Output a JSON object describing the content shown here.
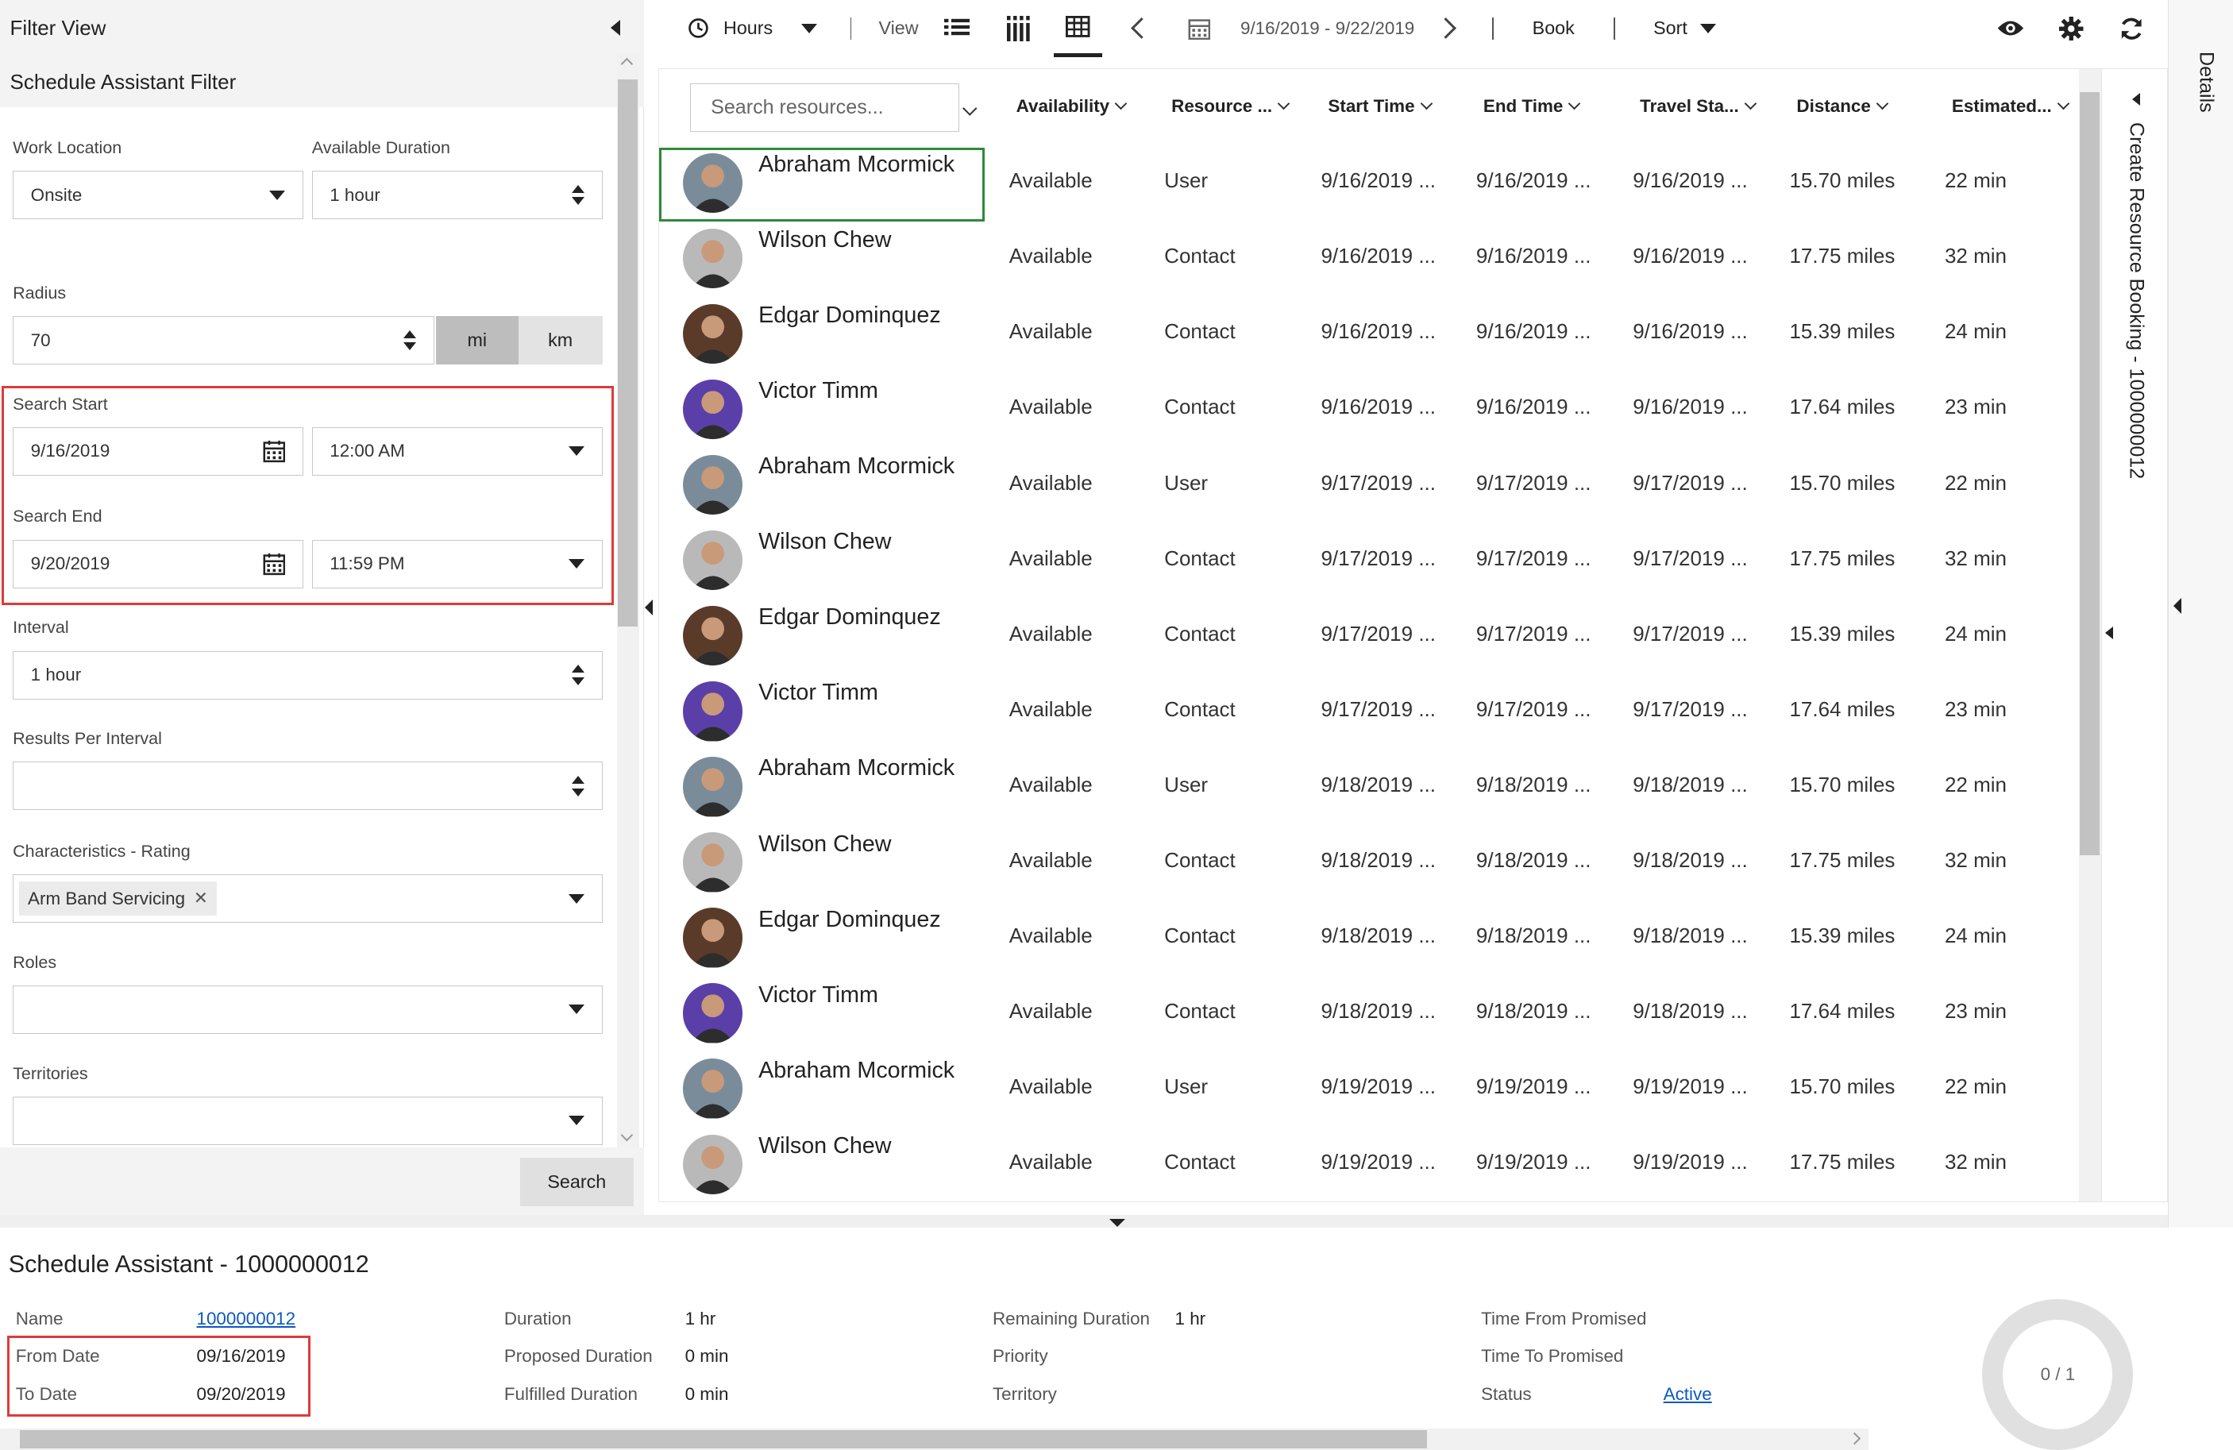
{
  "filter": {
    "title": "Filter View",
    "subtitle": "Schedule Assistant Filter",
    "work_location": {
      "label": "Work Location",
      "value": "Onsite"
    },
    "available_duration": {
      "label": "Available Duration",
      "value": "1 hour"
    },
    "radius": {
      "label": "Radius",
      "value": "70",
      "unit_mi": "mi",
      "unit_km": "km",
      "selected_unit": "mi"
    },
    "search_start": {
      "label": "Search Start",
      "date": "9/16/2019",
      "time": "12:00 AM"
    },
    "search_end": {
      "label": "Search End",
      "date": "9/20/2019",
      "time": "11:59 PM"
    },
    "interval": {
      "label": "Interval",
      "value": "1 hour"
    },
    "results_per_interval": {
      "label": "Results Per Interval",
      "value": ""
    },
    "characteristics": {
      "label": "Characteristics - Rating",
      "tag": "Arm Band Servicing"
    },
    "roles": {
      "label": "Roles",
      "value": ""
    },
    "territories": {
      "label": "Territories",
      "value": ""
    },
    "search_button": "Search"
  },
  "toolbar": {
    "hours": "Hours",
    "view": "View",
    "date_range": "9/16/2019 - 9/22/2019",
    "book": "Book",
    "sort": "Sort"
  },
  "grid": {
    "search_placeholder": "Search resources...",
    "columns": [
      "Availability",
      "Resource ...",
      "Start Time",
      "End Time",
      "Travel Sta...",
      "Distance",
      "Estimated..."
    ],
    "rows": [
      {
        "name": "Abraham Mcormick",
        "availability": "Available",
        "type": "User",
        "start": "9/16/2019 ...",
        "end": "9/16/2019 ...",
        "travel": "9/16/2019 ...",
        "distance": "15.70 miles",
        "est": "22 min",
        "avatar": "a"
      },
      {
        "name": "Wilson Chew",
        "availability": "Available",
        "type": "Contact",
        "start": "9/16/2019 ...",
        "end": "9/16/2019 ...",
        "travel": "9/16/2019 ...",
        "distance": "17.75 miles",
        "est": "32 min",
        "avatar": "w"
      },
      {
        "name": "Edgar Dominquez",
        "availability": "Available",
        "type": "Contact",
        "start": "9/16/2019 ...",
        "end": "9/16/2019 ...",
        "travel": "9/16/2019 ...",
        "distance": "15.39 miles",
        "est": "24 min",
        "avatar": "e"
      },
      {
        "name": "Victor Timm",
        "availability": "Available",
        "type": "Contact",
        "start": "9/16/2019 ...",
        "end": "9/16/2019 ...",
        "travel": "9/16/2019 ...",
        "distance": "17.64 miles",
        "est": "23 min",
        "avatar": "v"
      },
      {
        "name": "Abraham Mcormick",
        "availability": "Available",
        "type": "User",
        "start": "9/17/2019 ...",
        "end": "9/17/2019 ...",
        "travel": "9/17/2019 ...",
        "distance": "15.70 miles",
        "est": "22 min",
        "avatar": "a"
      },
      {
        "name": "Wilson Chew",
        "availability": "Available",
        "type": "Contact",
        "start": "9/17/2019 ...",
        "end": "9/17/2019 ...",
        "travel": "9/17/2019 ...",
        "distance": "17.75 miles",
        "est": "32 min",
        "avatar": "w"
      },
      {
        "name": "Edgar Dominquez",
        "availability": "Available",
        "type": "Contact",
        "start": "9/17/2019 ...",
        "end": "9/17/2019 ...",
        "travel": "9/17/2019 ...",
        "distance": "15.39 miles",
        "est": "24 min",
        "avatar": "e"
      },
      {
        "name": "Victor Timm",
        "availability": "Available",
        "type": "Contact",
        "start": "9/17/2019 ...",
        "end": "9/17/2019 ...",
        "travel": "9/17/2019 ...",
        "distance": "17.64 miles",
        "est": "23 min",
        "avatar": "v"
      },
      {
        "name": "Abraham Mcormick",
        "availability": "Available",
        "type": "User",
        "start": "9/18/2019 ...",
        "end": "9/18/2019 ...",
        "travel": "9/18/2019 ...",
        "distance": "15.70 miles",
        "est": "22 min",
        "avatar": "a"
      },
      {
        "name": "Wilson Chew",
        "availability": "Available",
        "type": "Contact",
        "start": "9/18/2019 ...",
        "end": "9/18/2019 ...",
        "travel": "9/18/2019 ...",
        "distance": "17.75 miles",
        "est": "32 min",
        "avatar": "w"
      },
      {
        "name": "Edgar Dominquez",
        "availability": "Available",
        "type": "Contact",
        "start": "9/18/2019 ...",
        "end": "9/18/2019 ...",
        "travel": "9/18/2019 ...",
        "distance": "15.39 miles",
        "est": "24 min",
        "avatar": "e"
      },
      {
        "name": "Victor Timm",
        "availability": "Available",
        "type": "Contact",
        "start": "9/18/2019 ...",
        "end": "9/18/2019 ...",
        "travel": "9/18/2019 ...",
        "distance": "17.64 miles",
        "est": "23 min",
        "avatar": "v"
      },
      {
        "name": "Abraham Mcormick",
        "availability": "Available",
        "type": "User",
        "start": "9/19/2019 ...",
        "end": "9/19/2019 ...",
        "travel": "9/19/2019 ...",
        "distance": "15.70 miles",
        "est": "22 min",
        "avatar": "a"
      },
      {
        "name": "Wilson Chew",
        "availability": "Available",
        "type": "Contact",
        "start": "9/19/2019 ...",
        "end": "9/19/2019 ...",
        "travel": "9/19/2019 ...",
        "distance": "17.75 miles",
        "est": "32 min",
        "avatar": "w"
      }
    ]
  },
  "side": {
    "create_booking": "Create Resource Booking - 1000000012",
    "details": "Details"
  },
  "bottom": {
    "title": "Schedule Assistant - 1000000012",
    "name_label": "Name",
    "name_value": "1000000012",
    "from_label": "From Date",
    "from_value": "09/16/2019",
    "to_label": "To Date",
    "to_value": "09/20/2019",
    "duration_label": "Duration",
    "duration_value": "1 hr",
    "proposed_label": "Proposed Duration",
    "proposed_value": "0 min",
    "fulfilled_label": "Fulfilled Duration",
    "fulfilled_value": "0 min",
    "remaining_label": "Remaining Duration",
    "remaining_value": "1 hr",
    "priority_label": "Priority",
    "territory_label": "Territory",
    "tfp_label": "Time From Promised",
    "ttp_label": "Time To Promised",
    "status_label": "Status",
    "status_value": "Active",
    "progress_text": "0 / 1"
  },
  "colors": {
    "accent": "#0b58c4",
    "highlight_border": "#e03a3a",
    "selected_border": "#2f8a3a",
    "avatar_a": "#7a8c99",
    "avatar_w": "#b9b9b9",
    "avatar_e": "#5a3b2a",
    "avatar_v": "#5b3fa8"
  }
}
